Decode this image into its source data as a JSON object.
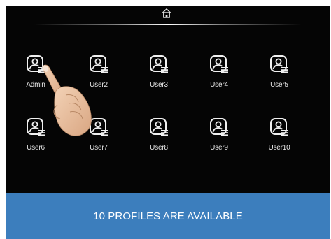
{
  "header": {
    "icon": "home-icon"
  },
  "profiles": [
    {
      "label": "Admin",
      "icon": "user-profile-icon"
    },
    {
      "label": "User2",
      "icon": "user-profile-icon"
    },
    {
      "label": "User3",
      "icon": "user-profile-icon"
    },
    {
      "label": "User4",
      "icon": "user-profile-icon"
    },
    {
      "label": "User5",
      "icon": "user-profile-icon"
    },
    {
      "label": "User6",
      "icon": "user-profile-icon"
    },
    {
      "label": "User7",
      "icon": "user-profile-icon"
    },
    {
      "label": "User8",
      "icon": "user-profile-icon"
    },
    {
      "label": "User9",
      "icon": "user-profile-icon"
    },
    {
      "label": "User10",
      "icon": "user-profile-icon"
    }
  ],
  "banner": {
    "text": "10 PROFILES ARE AVAILABLE"
  },
  "colors": {
    "screen_bg": "#050505",
    "banner_bg": "#3c7ebd",
    "text": "#e8e8e8"
  }
}
